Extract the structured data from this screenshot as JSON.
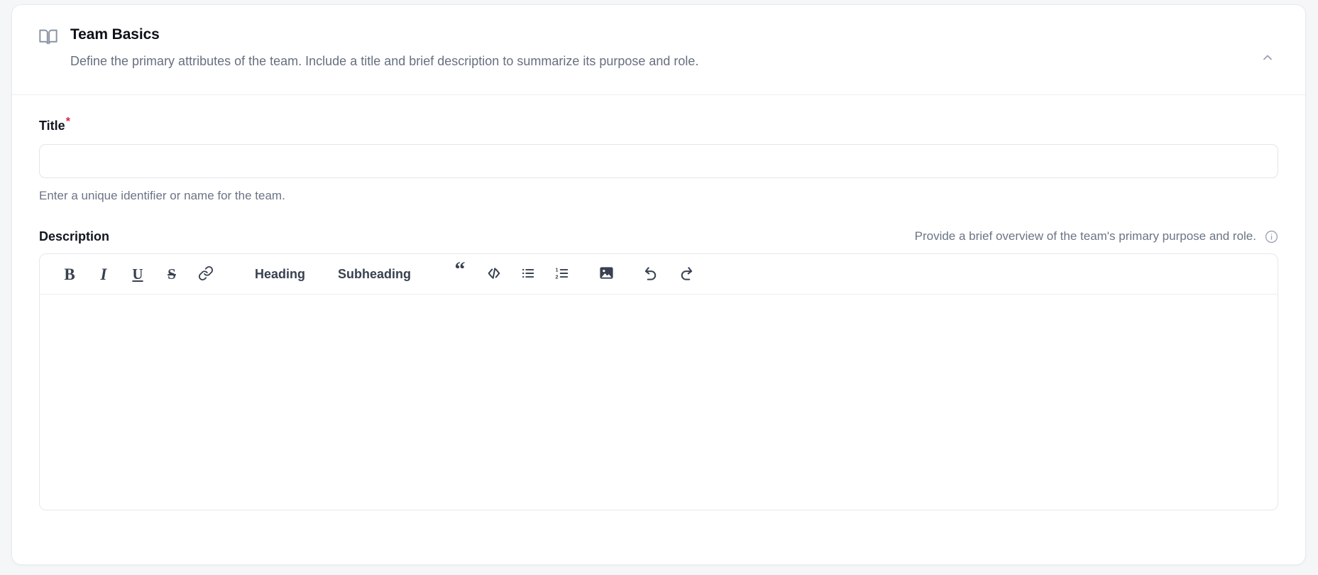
{
  "card": {
    "icon": "book-open-icon",
    "title": "Team Basics",
    "subtitle": "Define the primary attributes of the team. Include a title and brief description to summarize its purpose and role.",
    "collapse_icon": "chevron-up-icon",
    "collapsed": false
  },
  "title_field": {
    "label": "Title",
    "required_marker": "*",
    "value": "",
    "placeholder": "",
    "help": "Enter a unique identifier or name for the team."
  },
  "description_field": {
    "label": "Description",
    "hint": "Provide a brief overview of the team's primary purpose and role.",
    "info_icon": "info-circle-icon",
    "info_glyph": "i",
    "value": "",
    "placeholder": ""
  },
  "toolbar": {
    "items": [
      {
        "name": "bold-button",
        "kind": "glyph",
        "glyph": "B",
        "label": "Bold"
      },
      {
        "name": "italic-button",
        "kind": "glyph",
        "glyph": "I",
        "label": "Italic"
      },
      {
        "name": "underline-button",
        "kind": "glyph",
        "glyph": "U",
        "label": "Underline"
      },
      {
        "name": "strikethrough-button",
        "kind": "glyph",
        "glyph": "S",
        "label": "Strikethrough"
      },
      {
        "name": "link-button",
        "kind": "icon",
        "icon": "link-icon",
        "label": "Link"
      },
      {
        "name": "heading-button",
        "kind": "text",
        "text": "Heading",
        "label": "Heading"
      },
      {
        "name": "subheading-button",
        "kind": "text",
        "text": "Subheading",
        "label": "Subheading"
      },
      {
        "name": "blockquote-button",
        "kind": "glyph",
        "glyph": "“",
        "label": "Quote"
      },
      {
        "name": "code-button",
        "kind": "icon",
        "icon": "code-icon",
        "label": "Code"
      },
      {
        "name": "bullet-list-button",
        "kind": "icon",
        "icon": "bullet-list-icon",
        "label": "Bullet list"
      },
      {
        "name": "ordered-list-button",
        "kind": "icon",
        "icon": "ordered-list-icon",
        "label": "Numbered list"
      },
      {
        "name": "image-button",
        "kind": "icon",
        "icon": "image-icon",
        "label": "Image"
      },
      {
        "name": "undo-button",
        "kind": "icon",
        "icon": "undo-icon",
        "label": "Undo"
      },
      {
        "name": "redo-button",
        "kind": "icon",
        "icon": "redo-icon",
        "label": "Redo"
      }
    ],
    "heading_label": "Heading",
    "subheading_label": "Subheading"
  },
  "colors": {
    "page_background": "#f4f6f8",
    "card_background": "#ffffff",
    "border": "#e5e8ec",
    "title_text": "#0d1117",
    "muted_text": "#6b7485",
    "icon": "#394150",
    "required_asterisk": "#e11d48"
  }
}
